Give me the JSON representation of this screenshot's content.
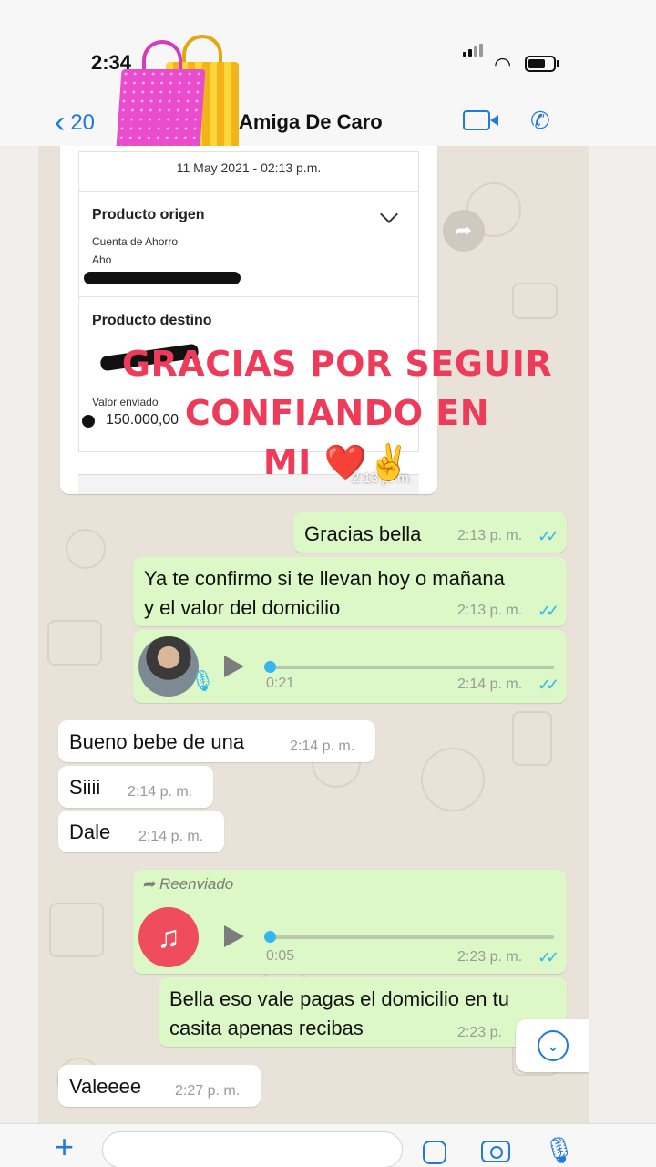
{
  "status_bar": {
    "time": "2:34"
  },
  "header": {
    "back_count": "20",
    "contact_name": "Amiga De Caro"
  },
  "forwarded_card": {
    "date": "11 May 2021 - 02:13 p.m.",
    "origin_title": "Producto origen",
    "origin_sub": "Cuenta de Ahorro",
    "origin_abbr": "Aho",
    "destination_title": "Producto destino",
    "value_label": "Valor enviado",
    "value_amount": "150.000,00",
    "timestamp": "2:13 p. m."
  },
  "story_caption": {
    "line1": "GRACIAS POR SEGUIR CONFIANDO EN",
    "line2": "MI",
    "heart": "❤️",
    "hand": "✌️"
  },
  "messages": [
    {
      "text": "Gracias bella",
      "time": "2:13 p. m."
    },
    {
      "line1": "Ya te confirmo si te llevan hoy o mañana",
      "line2": "y el valor del domicilio",
      "time": "2:13 p. m."
    },
    {
      "duration": "0:21",
      "time": "2:14 p. m."
    },
    {
      "text": "Bueno bebe de una",
      "time": "2:14 p. m."
    },
    {
      "text": "Siiii",
      "time": "2:14 p. m."
    },
    {
      "text": "Dale",
      "time": "2:14 p. m."
    },
    {
      "forward_label": "Reenviado",
      "duration": "0:05",
      "time": "2:23 p. m."
    },
    {
      "line1": "Bella eso vale pagas el domicilio en tu",
      "line2": "casita apenas recibas",
      "time": "2:23 p."
    },
    {
      "text": "Valeeee",
      "time": "2:27 p. m."
    }
  ],
  "icons": {
    "ticks": "✓✓",
    "back_chevron": "‹",
    "phone": "✆",
    "wifi": "◠",
    "mic": "🎙",
    "music": "♫",
    "plus": "+",
    "scroll_down": "⌄",
    "forward_arrow": "➦"
  }
}
